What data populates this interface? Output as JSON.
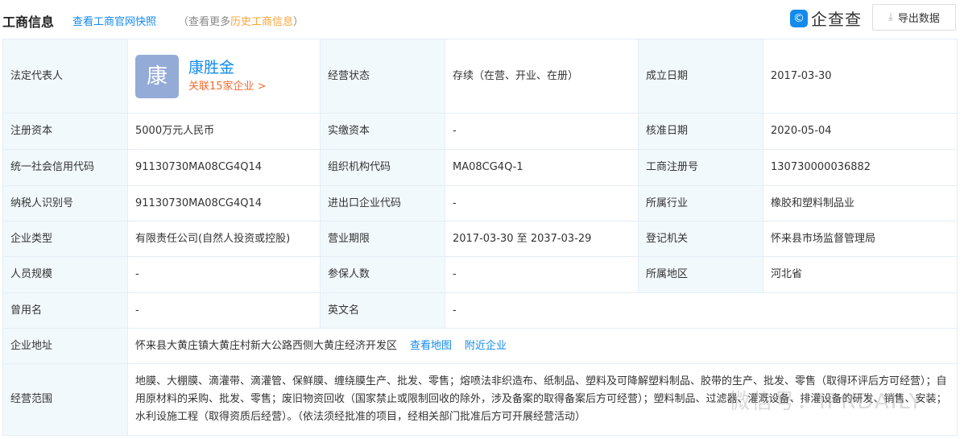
{
  "header": {
    "title": "工商信息",
    "snapshot_link": "查看工商官网快照",
    "more_prefix": "（查看更多",
    "more_link": "历史工商信息",
    "more_suffix": "）",
    "logo_text": "企查查",
    "export_label": "导出数据"
  },
  "legal": {
    "label": "法定代表人",
    "avatar_char": "康",
    "name": "康胜金",
    "related": "关联15家企业 >"
  },
  "rows": [
    [
      "经营状态",
      "存续（在营、开业、在册）",
      "成立日期",
      "2017-03-30"
    ],
    [
      "注册资本",
      "5000万元人民币",
      "实缴资本",
      "-",
      "核准日期",
      "2020-05-04"
    ],
    [
      "统一社会信用代码",
      "91130730MA08CG4Q14",
      "组织机构代码",
      "MA08CG4Q-1",
      "工商注册号",
      "130730000036882"
    ],
    [
      "纳税人识别号",
      "91130730MA08CG4Q14",
      "进出口企业代码",
      "-",
      "所属行业",
      "橡胶和塑料制品业"
    ],
    [
      "企业类型",
      "有限责任公司(自然人投资或控股)",
      "营业期限",
      "2017-03-30 至 2037-03-29",
      "登记机关",
      "怀来县市场监督管理局"
    ],
    [
      "人员规模",
      "-",
      "参保人数",
      "-",
      "所属地区",
      "河北省"
    ],
    [
      "曾用名",
      "-",
      "英文名",
      "-"
    ]
  ],
  "address": {
    "label": "企业地址",
    "value": "怀来县大黄庄镇大黄庄村新大公路西侧大黄庄经济开发区",
    "map_link": "查看地图",
    "nearby_link": "附近企业"
  },
  "scope": {
    "label": "经营范围",
    "value": "地膜、大棚膜、滴灌带、滴灌管、保鲜膜、缠绕膜生产、批发、零售；熔喷法非织造布、纸制品、塑料及可降解塑料制品、胶带的生产、批发、零售（取得环评后方可经营）；自用原材料的采购、批发、零售；废旧物资回收（国家禁止或限制回收的除外，涉及备案的取得备案后方可经营）；塑料制品、过滤器、灌溉设备、排灌设备的研发、销售、安装；水利设施工程（取得资质后经营）。（依法须经批准的项目，经相关部门批准后方可开展经营活动）"
  },
  "watermark": "微信号：IPRDAILY"
}
